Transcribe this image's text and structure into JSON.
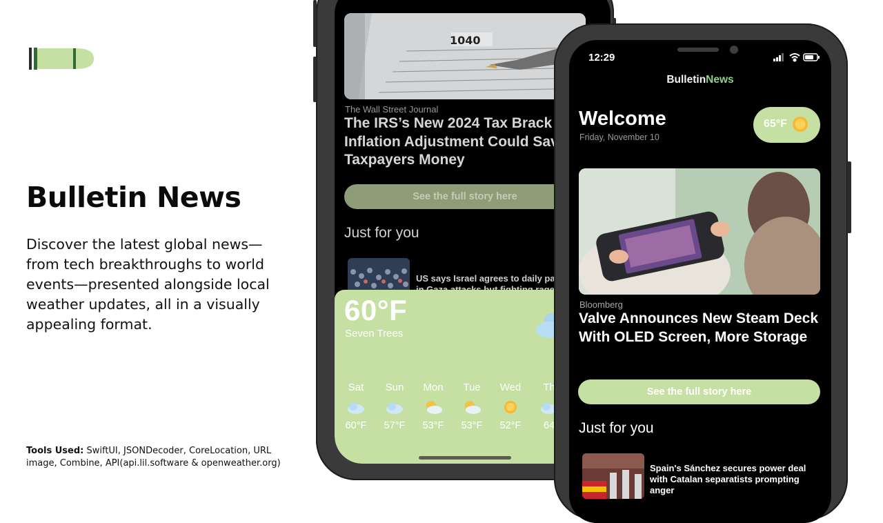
{
  "app": {
    "title": "Bulletin News",
    "description": "Discover the latest global news—from tech breakthroughs to world events—presented alongside local weather updates, all in a visually appealing format.",
    "tools_label": "Tools Used:",
    "tools_value": " SwiftUI, JSONDecoder, CoreLocation, URL image, Combine, API(api.lil.software & openweather.org)"
  },
  "back_phone": {
    "featured": {
      "source": "The Wall Street Journal",
      "headline": "The IRS’s New 2024 Tax Brack\nInflation Adjustment Could Sav\nTaxpayers Money",
      "button": "See the full story here"
    },
    "section_title": "Just for you",
    "related_line1": "US says Israel agrees to daily pa",
    "related_line2": "in Gaza attacks but fighting rage",
    "weather": {
      "temperature": "60°F",
      "location": "Seven Trees",
      "forecast": [
        {
          "day": "Sat",
          "icon": "partly-cloudy-icon",
          "temp": "60°F"
        },
        {
          "day": "Sun",
          "icon": "partly-cloudy-icon",
          "temp": "57°F"
        },
        {
          "day": "Mon",
          "icon": "sun-behind-cloud-icon",
          "temp": "53°F"
        },
        {
          "day": "Tue",
          "icon": "sun-behind-cloud-icon",
          "temp": "53°F"
        },
        {
          "day": "Wed",
          "icon": "sun-icon",
          "temp": "52°F"
        },
        {
          "day": "Th",
          "icon": "partly-cloudy-icon",
          "temp": "64"
        }
      ]
    }
  },
  "front_phone": {
    "status_time": "12:29",
    "brand_main": "Bulletin",
    "brand_accent": "News",
    "welcome": "Welcome",
    "date": "Friday, November 10",
    "current_temp": "65°F",
    "featured": {
      "source": "Bloomberg",
      "headline": "Valve Announces New Steam Deck With OLED Screen, More Storage",
      "button": "See the full story here"
    },
    "section_title": "Just for you",
    "related_title": "Spain's Sánchez secures power deal with Catalan separatists prompting anger"
  },
  "colors": {
    "accent_green": "#c5e0a2",
    "brand_green": "#8fd18a",
    "logo_dark_green": "#2e6b37",
    "screen_bg": "#000000"
  }
}
